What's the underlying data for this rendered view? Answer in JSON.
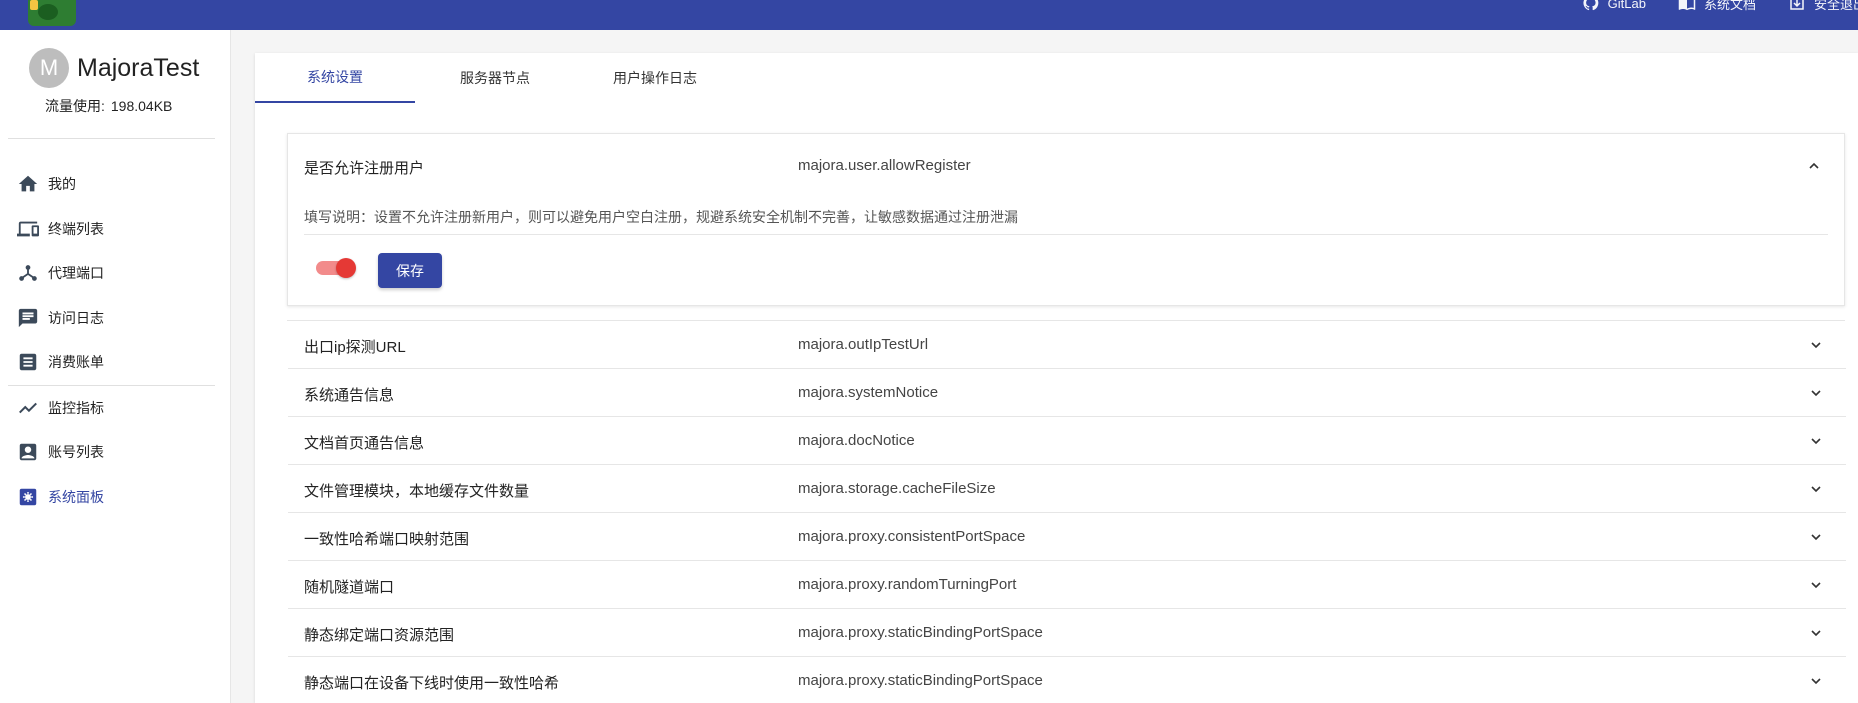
{
  "topbar": {
    "links": [
      {
        "label": "GitLab",
        "icon": "github-icon"
      },
      {
        "label": "系统文档",
        "icon": "book-icon"
      },
      {
        "label": "安全退出",
        "icon": "logout-icon"
      }
    ]
  },
  "user": {
    "avatar_letter": "M",
    "name": "MajoraTest",
    "traffic_label": "流量使用:",
    "traffic_value": "198.04KB"
  },
  "sidebar": {
    "items": [
      {
        "label": "我的",
        "icon": "home-icon"
      },
      {
        "label": "终端列表",
        "icon": "devices-icon"
      },
      {
        "label": "代理端口",
        "icon": "network-icon"
      },
      {
        "label": "访问日志",
        "icon": "message-icon"
      },
      {
        "label": "消费账单",
        "icon": "list-icon"
      },
      {
        "label": "监控指标",
        "icon": "trending-icon"
      },
      {
        "label": "账号列表",
        "icon": "account-box-icon"
      },
      {
        "label": "系统面板",
        "icon": "settings-panel-icon",
        "active": true
      }
    ]
  },
  "tabs": [
    {
      "label": "系统设置",
      "active": true
    },
    {
      "label": "服务器节点"
    },
    {
      "label": "用户操作日志"
    }
  ],
  "expanded_setting": {
    "title": "是否允许注册用户",
    "key": "majora.user.allowRegister",
    "description": "填写说明：设置不允许注册新用户，则可以避免用户空白注册，规避系统安全机制不完善，让敏感数据通过注册泄漏",
    "toggle_on": true,
    "save_label": "保存"
  },
  "settings": [
    {
      "title": "出口ip探测URL",
      "key": "majora.outIpTestUrl"
    },
    {
      "title": "系统通告信息",
      "key": "majora.systemNotice"
    },
    {
      "title": "文档首页通告信息",
      "key": "majora.docNotice"
    },
    {
      "title": "文件管理模块，本地缓存文件数量",
      "key": "majora.storage.cacheFileSize"
    },
    {
      "title": "一致性哈希端口映射范围",
      "key": "majora.proxy.consistentPortSpace"
    },
    {
      "title": "随机隧道端口",
      "key": "majora.proxy.randomTurningPort"
    },
    {
      "title": "静态绑定端口资源范围",
      "key": "majora.proxy.staticBindingPortSpace"
    },
    {
      "title": "静态端口在设备下线时使用一致性哈希",
      "key": "majora.proxy.staticBindingPortSpace"
    }
  ],
  "colors": {
    "primary": "#3446a3",
    "toggle_on": "#e53935"
  }
}
